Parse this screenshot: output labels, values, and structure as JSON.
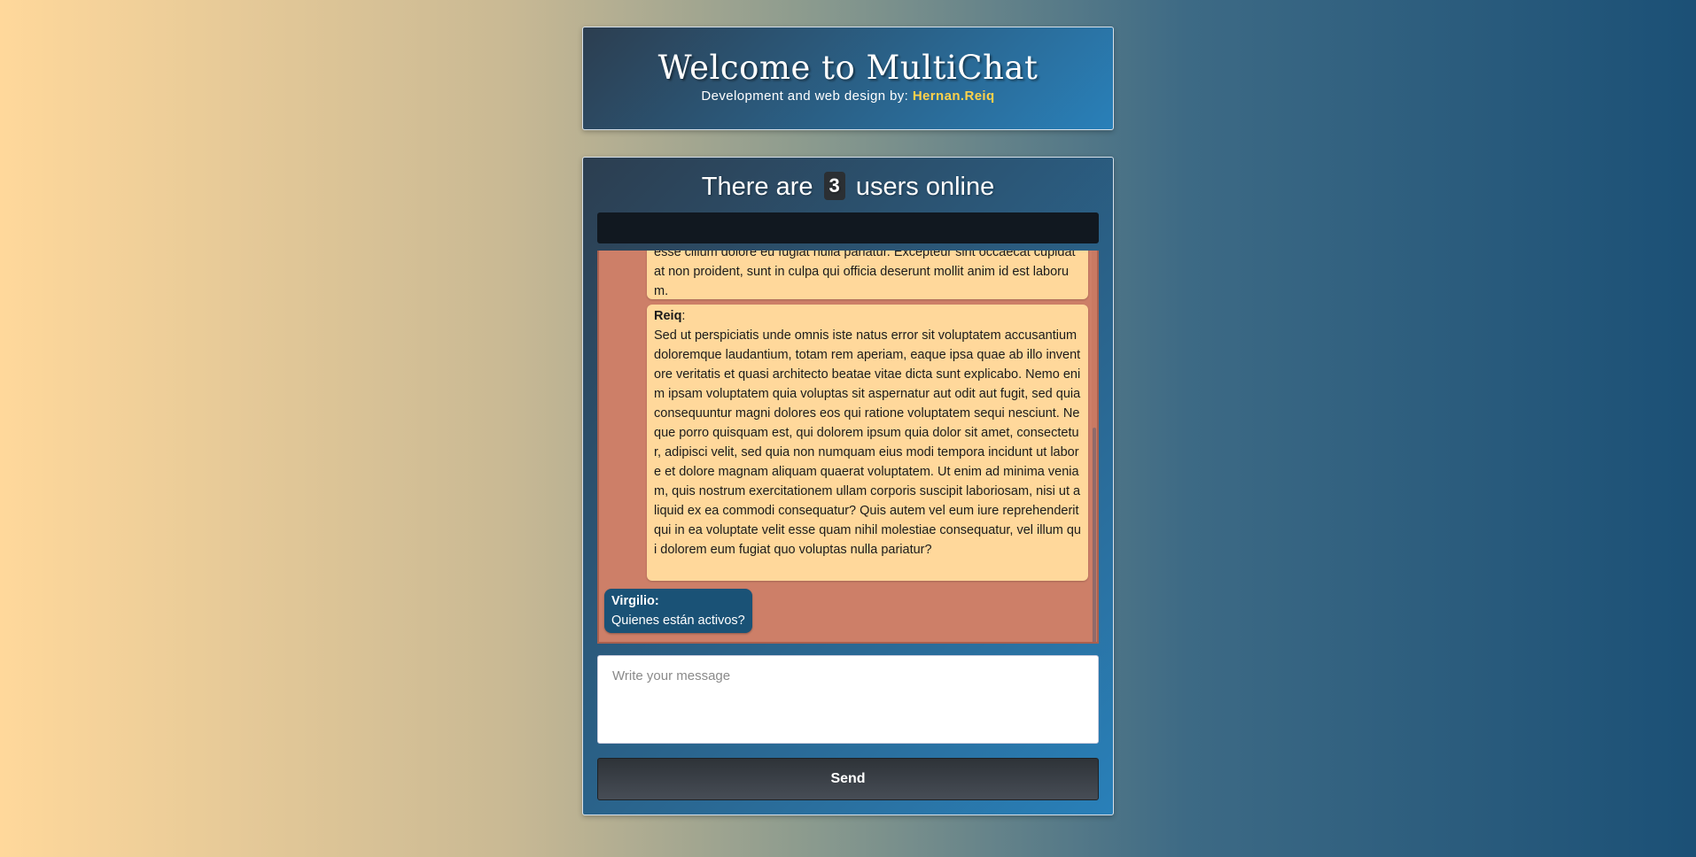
{
  "header": {
    "title": "Welcome to MultiChat",
    "subtitle_prefix": "Development and web design by:",
    "author": "Hernan.Reiq"
  },
  "chat": {
    "online_prefix": "There are",
    "online_count": "3",
    "online_suffix": "users online",
    "messages": [
      {
        "user": "",
        "text": "esse cillum dolore eu fugiat nulla pariatur. Excepteur sint occaecat cupidatat non proident, sunt in culpa qui officia deserunt mollit anim id est laborum."
      },
      {
        "user": "Reiq",
        "text": "Sed ut perspiciatis unde omnis iste natus error sit voluptatem accusantium doloremque laudantium, totam rem aperiam, eaque ipsa quae ab illo inventore veritatis et quasi architecto beatae vitae dicta sunt explicabo. Nemo enim ipsam voluptatem quia voluptas sit aspernatur aut odit aut fugit, sed quia consequuntur magni dolores eos qui ratione voluptatem sequi nesciunt. Neque porro quisquam est, qui dolorem ipsum quia dolor sit amet, consectetur, adipisci velit, sed quia non numquam eius modi tempora incidunt ut labore et dolore magnam aliquam quaerat voluptatem. Ut enim ad minima veniam, quis nostrum exercitationem ullam corporis suscipit laboriosam, nisi ut aliquid ex ea commodi consequatur? Quis autem vel eum iure reprehenderit qui in ea voluptate velit esse quam nihil molestiae consequatur, vel illum qui dolorem eum fugiat quo voluptas nulla pariatur?"
      },
      {
        "user": "Virgilio:",
        "text": "Quienes están activos?"
      }
    ],
    "input_placeholder": "Write your message",
    "input_value": "",
    "send_label": "Send"
  },
  "colors": {
    "own_message_bg": "#ffd89b",
    "other_message_bg": "#1a5276",
    "messages_bg": "#cd7f68",
    "author_accent": "#ffd24a"
  }
}
